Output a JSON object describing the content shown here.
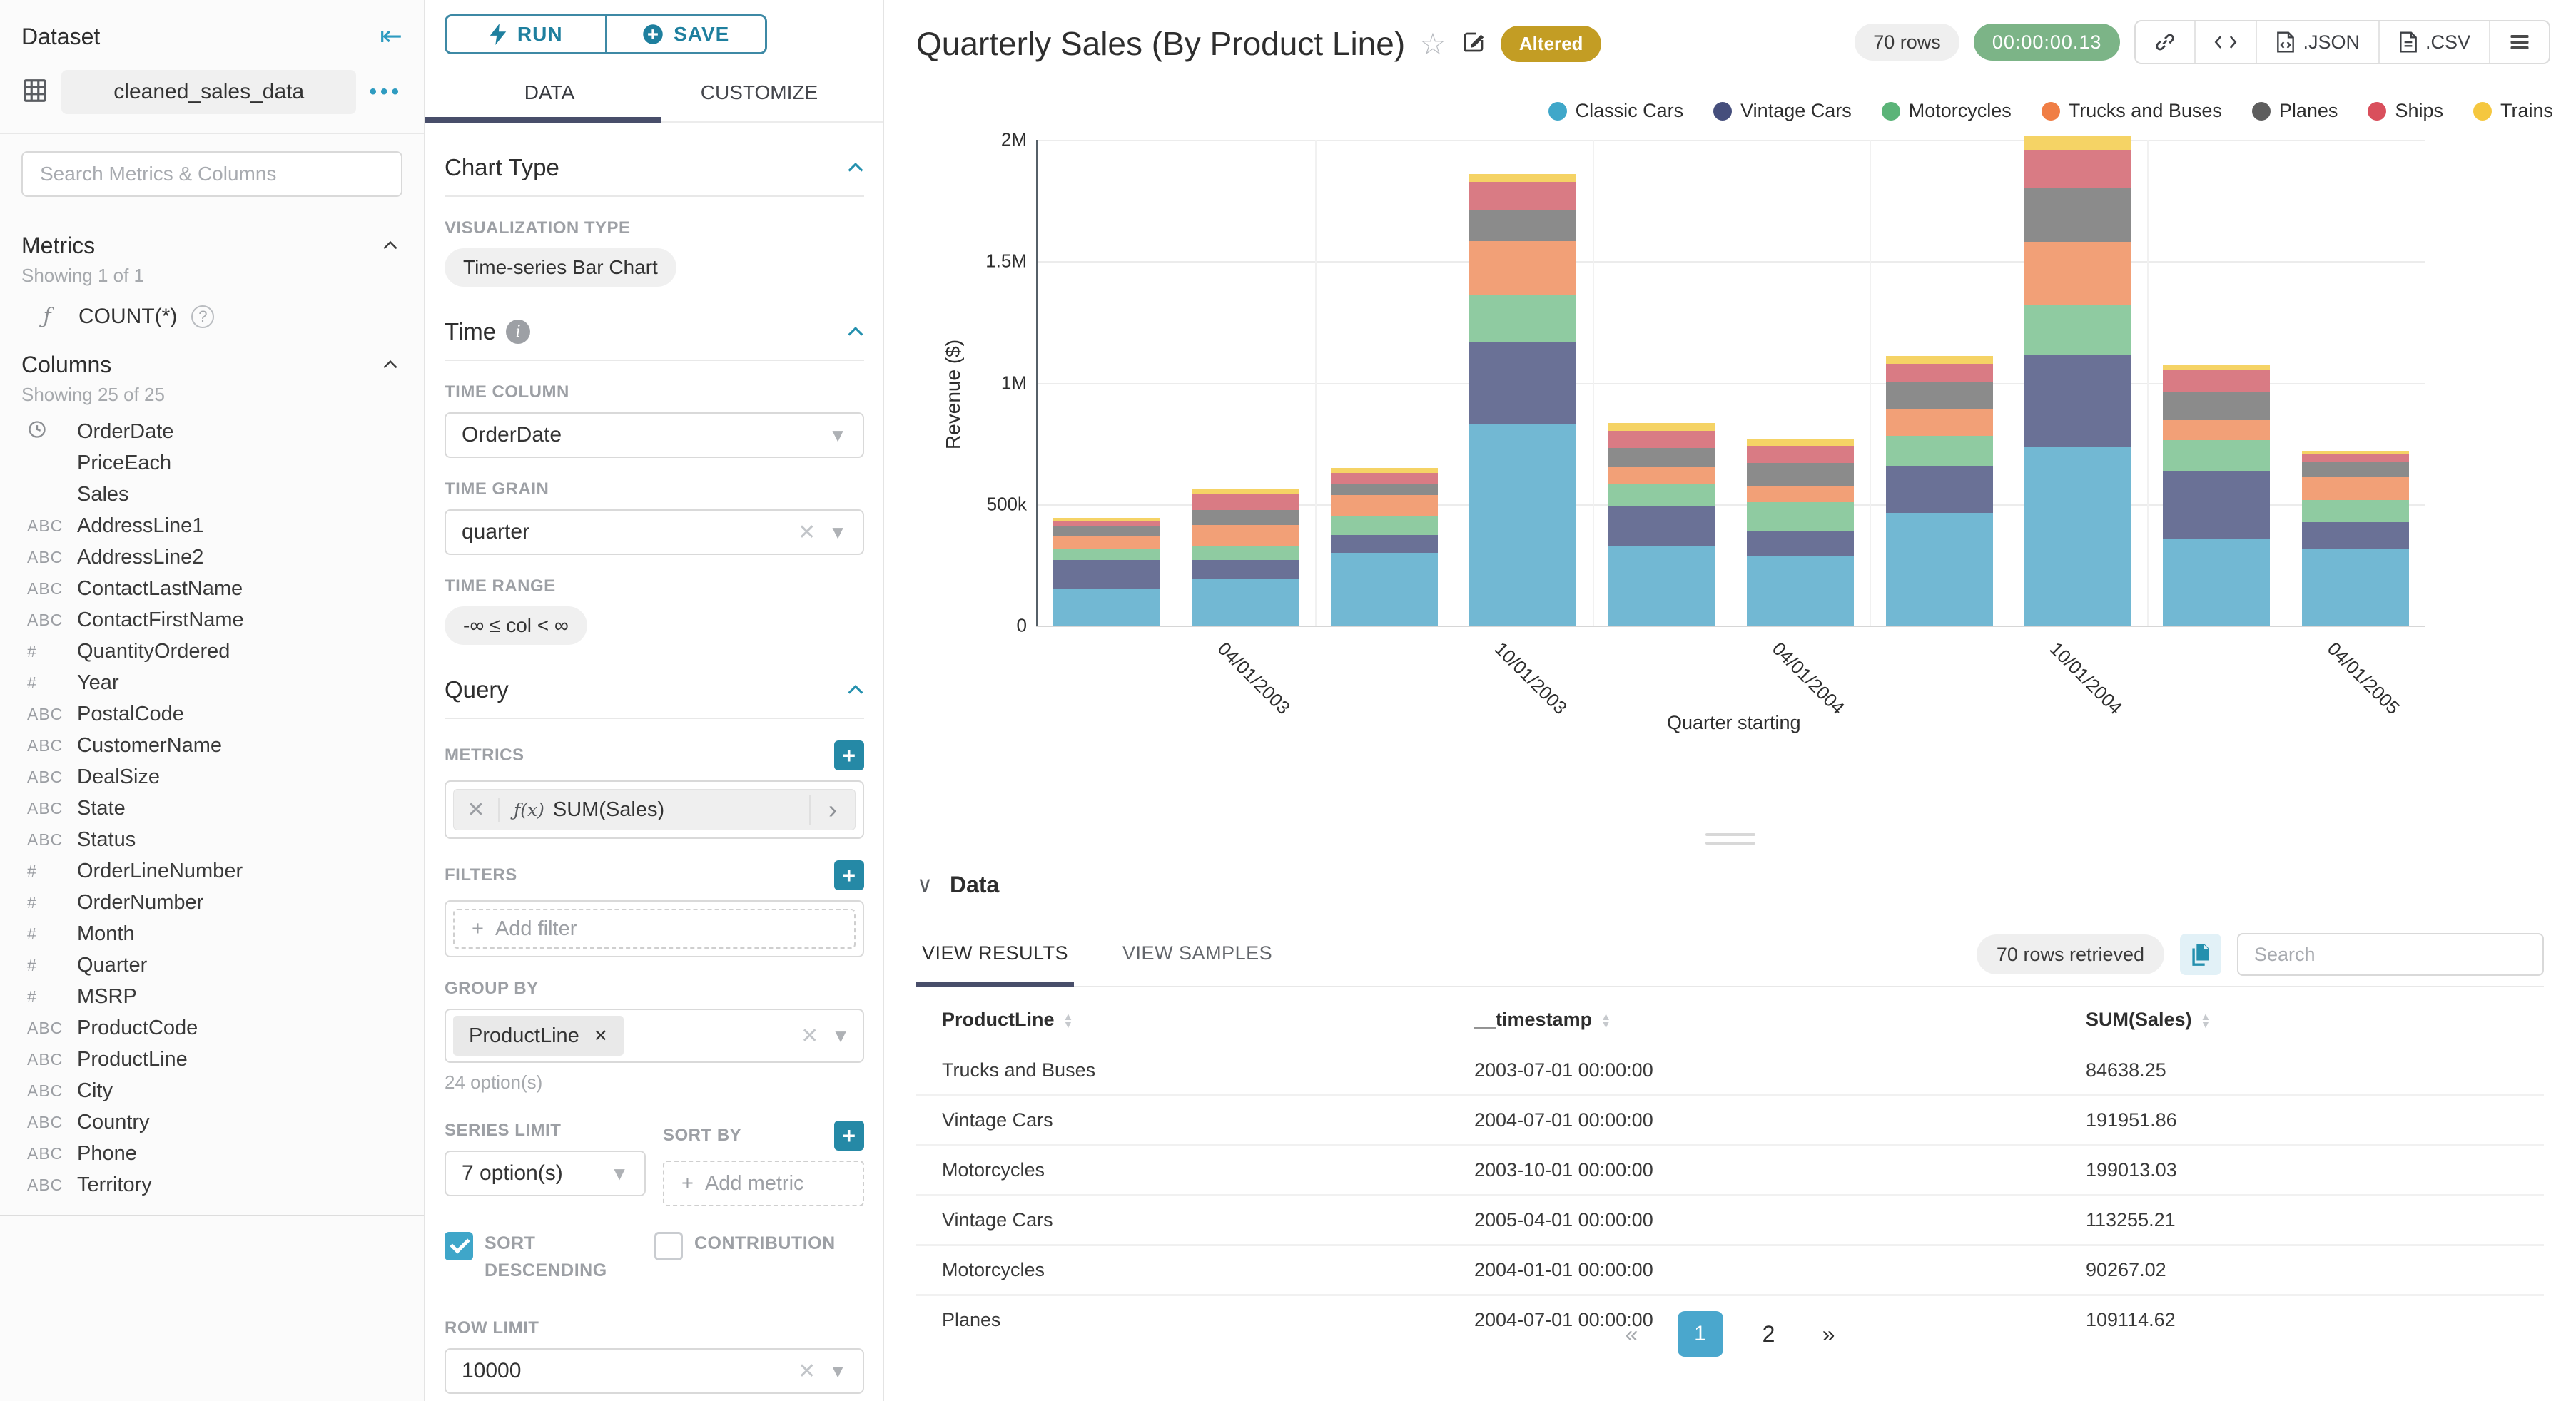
{
  "sidebar": {
    "title": "Dataset",
    "dataset_name": "cleaned_sales_data",
    "search_placeholder": "Search Metrics & Columns",
    "metrics_section": {
      "title": "Metrics",
      "showing": "Showing 1 of 1",
      "metric_name": "COUNT(*)"
    },
    "columns_section": {
      "title": "Columns",
      "showing": "Showing 25 of 25",
      "items": [
        {
          "type": "time",
          "name": "OrderDate"
        },
        {
          "type": "",
          "name": "PriceEach"
        },
        {
          "type": "",
          "name": "Sales"
        },
        {
          "type": "str",
          "name": "AddressLine1"
        },
        {
          "type": "str",
          "name": "AddressLine2"
        },
        {
          "type": "str",
          "name": "ContactLastName"
        },
        {
          "type": "str",
          "name": "ContactFirstName"
        },
        {
          "type": "num",
          "name": "QuantityOrdered"
        },
        {
          "type": "num",
          "name": "Year"
        },
        {
          "type": "str",
          "name": "PostalCode"
        },
        {
          "type": "str",
          "name": "CustomerName"
        },
        {
          "type": "str",
          "name": "DealSize"
        },
        {
          "type": "str",
          "name": "State"
        },
        {
          "type": "str",
          "name": "Status"
        },
        {
          "type": "num",
          "name": "OrderLineNumber"
        },
        {
          "type": "num",
          "name": "OrderNumber"
        },
        {
          "type": "num",
          "name": "Month"
        },
        {
          "type": "num",
          "name": "Quarter"
        },
        {
          "type": "num",
          "name": "MSRP"
        },
        {
          "type": "str",
          "name": "ProductCode"
        },
        {
          "type": "str",
          "name": "ProductLine"
        },
        {
          "type": "str",
          "name": "City"
        },
        {
          "type": "str",
          "name": "Country"
        },
        {
          "type": "str",
          "name": "Phone"
        },
        {
          "type": "str",
          "name": "Territory"
        }
      ],
      "badge_str": "ABC",
      "badge_num": "#"
    }
  },
  "controls": {
    "run_label": "RUN",
    "save_label": "SAVE",
    "tab_data": "DATA",
    "tab_customize": "CUSTOMIZE",
    "chart_type_section": {
      "title": "Chart Type",
      "viz_label": "VISUALIZATION TYPE",
      "viz_value": "Time-series Bar Chart"
    },
    "time_section": {
      "title": "Time",
      "time_column_label": "TIME COLUMN",
      "time_column_value": "OrderDate",
      "time_grain_label": "TIME GRAIN",
      "time_grain_value": "quarter",
      "time_range_label": "TIME RANGE",
      "time_range_value": "-∞ ≤ col < ∞"
    },
    "query_section": {
      "title": "Query",
      "metrics_label": "METRICS",
      "metric_fx": "ƒ(x)",
      "metric_value": "SUM(Sales)",
      "filters_label": "FILTERS",
      "add_filter_label": "Add filter",
      "group_by_label": "GROUP BY",
      "group_by_chip": "ProductLine",
      "group_by_hint": "24 option(s)",
      "series_limit_label": "SERIES LIMIT",
      "series_limit_value": "7 option(s)",
      "sort_by_label": "SORT BY",
      "add_metric_label": "Add metric",
      "sort_descending_label": "SORT DESCENDING",
      "contribution_label": "CONTRIBUTION",
      "row_limit_label": "ROW LIMIT",
      "row_limit_value": "10000"
    }
  },
  "header": {
    "title": "Quarterly Sales (By Product Line)",
    "altered_badge": "Altered",
    "rows_badge": "70 rows",
    "timer": "00:00:00.13",
    "export_json_label": ".JSON",
    "export_csv_label": ".CSV"
  },
  "chart_data": {
    "type": "bar",
    "stacked": true,
    "title": "Quarterly Sales (By Product Line)",
    "xlabel": "Quarter starting",
    "ylabel": "Revenue ($)",
    "ylim": [
      0,
      2000000
    ],
    "grid": true,
    "legend_position": "top-right",
    "x": [
      "2003-01-01",
      "2003-04-01",
      "2003-07-01",
      "2003-10-01",
      "2004-01-01",
      "2004-04-01",
      "2004-07-01",
      "2004-10-01",
      "2005-01-01",
      "2005-04-01"
    ],
    "x_tick_labels": {
      "1": "04/01/2003",
      "3": "10/01/2003",
      "5": "04/01/2004",
      "7": "10/01/2004",
      "9": "04/01/2005"
    },
    "y_ticks": [
      {
        "value": 0,
        "label": "0"
      },
      {
        "value": 500000,
        "label": "500k"
      },
      {
        "value": 1000000,
        "label": "1M"
      },
      {
        "value": 1500000,
        "label": "1.5M"
      },
      {
        "value": 2000000,
        "label": "2M"
      }
    ],
    "series": [
      {
        "name": "Classic Cars",
        "legend_color": "#3FA7C9",
        "bar_color": "#72B8D3",
        "values": [
          150000,
          195000,
          300000,
          830000,
          327000,
          289000,
          465000,
          735000,
          358000,
          314000
        ]
      },
      {
        "name": "Vintage Cars",
        "legend_color": "#454E7C",
        "bar_color": "#6A7196",
        "values": [
          120000,
          75000,
          73000,
          335000,
          166000,
          99000,
          191951.86,
          380000,
          280000,
          113255.21
        ]
      },
      {
        "name": "Motorcycles",
        "legend_color": "#5BB478",
        "bar_color": "#8FCBA1",
        "values": [
          45000,
          60000,
          80000,
          199013.03,
          90267.02,
          121000,
          125000,
          205000,
          127000,
          91000
        ]
      },
      {
        "name": "Trucks and Buses",
        "legend_color": "#F07E45",
        "bar_color": "#F2A077",
        "values": [
          52000,
          85000,
          84638.25,
          220000,
          73000,
          68000,
          112000,
          260000,
          80000,
          95000
        ]
      },
      {
        "name": "Planes",
        "legend_color": "#5E5E5E",
        "bar_color": "#8B8B8B",
        "values": [
          43000,
          60000,
          47000,
          124000,
          74000,
          94000,
          109114.62,
          220000,
          115000,
          60000
        ]
      },
      {
        "name": "Ships",
        "legend_color": "#D94F5C",
        "bar_color": "#D97B84",
        "values": [
          20000,
          67000,
          45000,
          120000,
          73000,
          68000,
          74000,
          160000,
          90000,
          33000
        ]
      },
      {
        "name": "Trains",
        "legend_color": "#F5C73F",
        "bar_color": "#F5D365",
        "values": [
          15000,
          20000,
          20000,
          32000,
          30000,
          27000,
          32000,
          55000,
          22000,
          13000
        ]
      }
    ]
  },
  "data_panel": {
    "title": "Data",
    "tab_results": "VIEW RESULTS",
    "tab_samples": "VIEW SAMPLES",
    "rows_retrieved": "70 rows retrieved",
    "search_placeholder": "Search",
    "columns": [
      "ProductLine",
      "__timestamp",
      "SUM(Sales)"
    ],
    "rows": [
      [
        "Trucks and Buses",
        "2003-07-01 00:00:00",
        "84638.25"
      ],
      [
        "Vintage Cars",
        "2004-07-01 00:00:00",
        "191951.86"
      ],
      [
        "Motorcycles",
        "2003-10-01 00:00:00",
        "199013.03"
      ],
      [
        "Vintage Cars",
        "2005-04-01 00:00:00",
        "113255.21"
      ],
      [
        "Motorcycles",
        "2004-01-01 00:00:00",
        "90267.02"
      ],
      [
        "Planes",
        "2004-07-01 00:00:00",
        "109114.62"
      ]
    ],
    "pagination": {
      "prev": "«",
      "pages": [
        "1",
        "2"
      ],
      "active_page": "1",
      "next": "»"
    }
  }
}
